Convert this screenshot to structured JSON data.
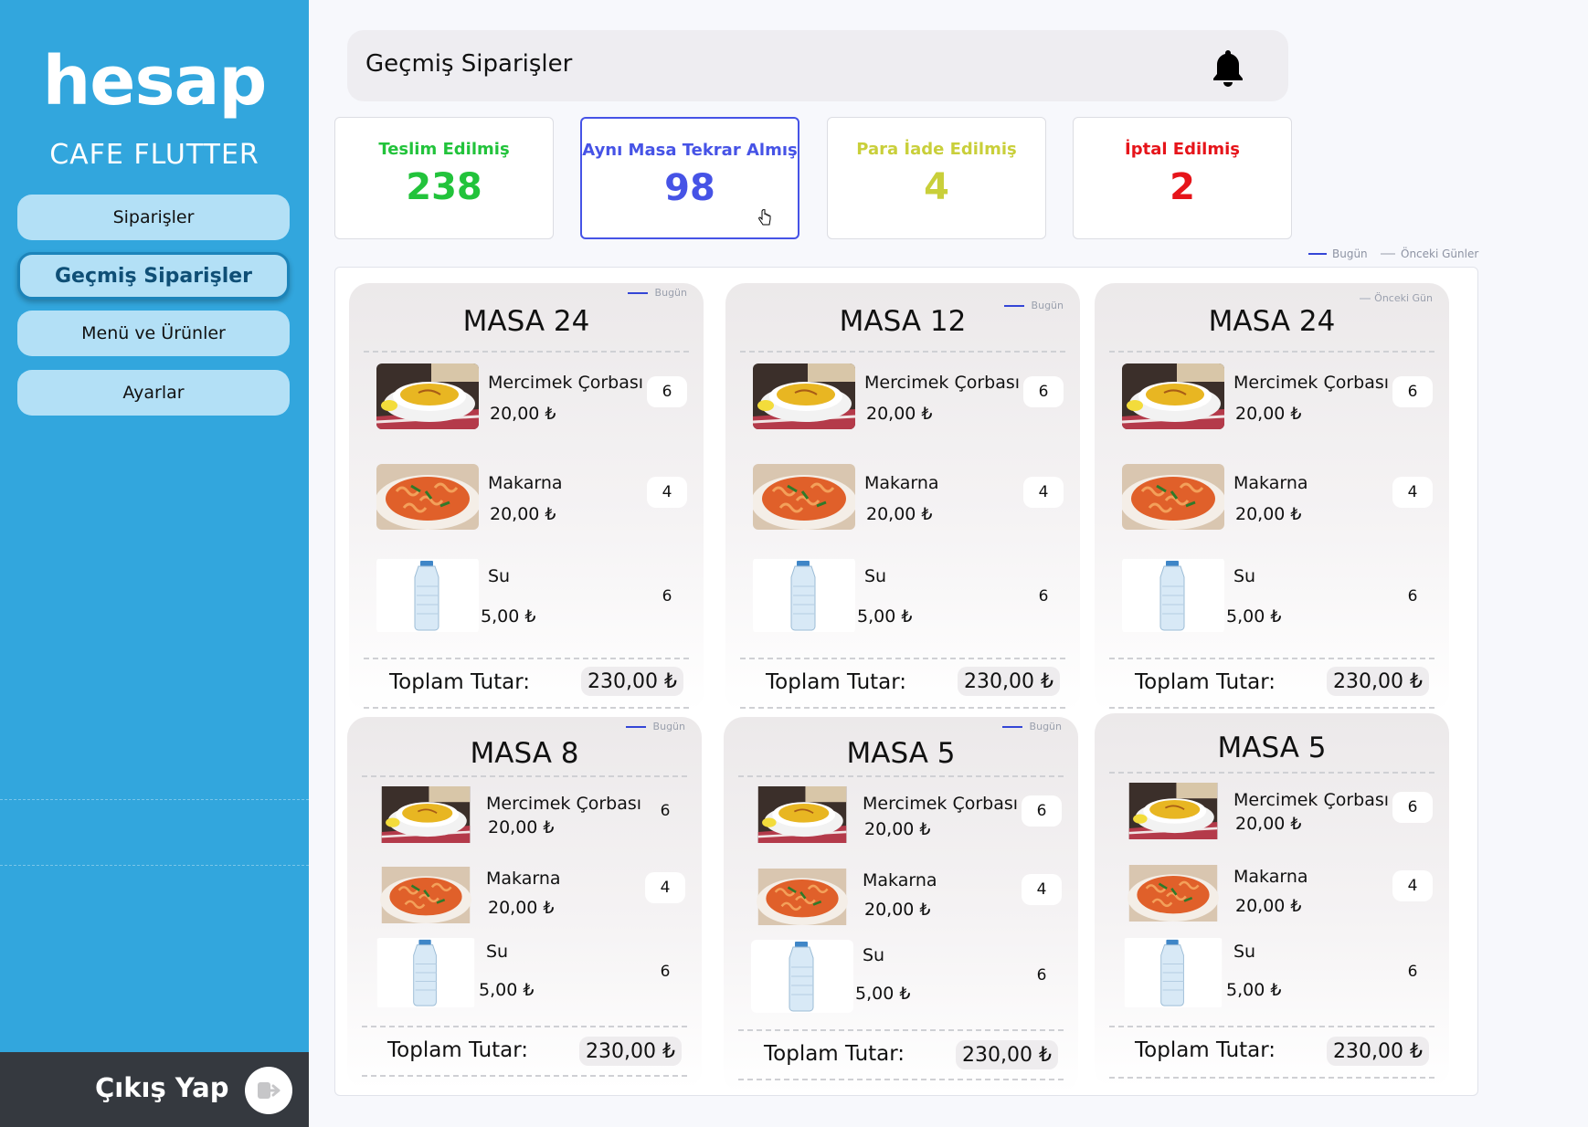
{
  "app": {
    "logo": "hesap",
    "brand": "CAFE FLUTTER"
  },
  "sidebar": {
    "items": [
      {
        "label": "Siparişler",
        "active": false
      },
      {
        "label": "Geçmiş Siparişler",
        "active": true
      },
      {
        "label": "Menü ve Ürünler",
        "active": false
      },
      {
        "label": "Ayarlar",
        "active": false
      }
    ],
    "logout_label": "Çıkış Yap"
  },
  "header": {
    "title": "Geçmiş Siparişler",
    "icon": "bell-icon"
  },
  "stats": [
    {
      "label": "Teslim Edilmiş",
      "value": "238",
      "color": "#22c33b"
    },
    {
      "label": "Aynı Masa Tekrar Almış",
      "value": "98",
      "color": "#4653e6"
    },
    {
      "label": "Para İade Edilmiş",
      "value": "4",
      "color": "#c9cf3a"
    },
    {
      "label": "İptal Edilmiş",
      "value": "2",
      "color": "#e6141a"
    }
  ],
  "legend": {
    "today": "Bugün",
    "previous": "Önceki Günler",
    "today_color": "#3446d6",
    "previous_color": "#c8cbd3"
  },
  "orders": [
    {
      "table": "MASA 24",
      "badge": "Bugün",
      "items": [
        {
          "name": "Mercimek Çorbası",
          "price": "20,00 ₺",
          "qty": "6",
          "image": "lentil-soup"
        },
        {
          "name": "Makarna",
          "price": "20,00 ₺",
          "qty": "4",
          "image": "pasta"
        },
        {
          "name": "Su",
          "price": "5,00 ₺",
          "qty": "6",
          "image": "water-bottle"
        }
      ],
      "total_label": "Toplam Tutar:",
      "total": "230,00 ₺"
    },
    {
      "table": "MASA 12",
      "badge": "Bugün",
      "items": [
        {
          "name": "Mercimek Çorbası",
          "price": "20,00 ₺",
          "qty": "6",
          "image": "lentil-soup"
        },
        {
          "name": "Makarna",
          "price": "20,00 ₺",
          "qty": "4",
          "image": "pasta"
        },
        {
          "name": "Su",
          "price": "5,00 ₺",
          "qty": "6",
          "image": "water-bottle"
        }
      ],
      "total_label": "Toplam Tutar:",
      "total": "230,00 ₺"
    },
    {
      "table": "MASA 24",
      "badge": "Önceki Gün",
      "items": [
        {
          "name": "Mercimek Çorbası",
          "price": "20,00 ₺",
          "qty": "6",
          "image": "lentil-soup"
        },
        {
          "name": "Makarna",
          "price": "20,00 ₺",
          "qty": "4",
          "image": "pasta"
        },
        {
          "name": "Su",
          "price": "5,00 ₺",
          "qty": "6",
          "image": "water-bottle"
        }
      ],
      "total_label": "Toplam Tutar:",
      "total": "230,00 ₺"
    },
    {
      "table": "MASA 8",
      "badge": "Bugün",
      "items": [
        {
          "name": "Mercimek Çorbası",
          "price": "20,00 ₺",
          "qty": "6",
          "image": "lentil-soup"
        },
        {
          "name": "Makarna",
          "price": "20,00 ₺",
          "qty": "4",
          "image": "pasta"
        },
        {
          "name": "Su",
          "price": "5,00 ₺",
          "qty": "6",
          "image": "water-bottle"
        }
      ],
      "total_label": "Toplam Tutar:",
      "total": "230,00 ₺"
    },
    {
      "table": "MASA 5",
      "badge": "Bugün",
      "items": [
        {
          "name": "Mercimek Çorbası",
          "price": "20,00 ₺",
          "qty": "6",
          "image": "lentil-soup"
        },
        {
          "name": "Makarna",
          "price": "20,00 ₺",
          "qty": "4",
          "image": "pasta"
        },
        {
          "name": "Su",
          "price": "5,00 ₺",
          "qty": "6",
          "image": "water-bottle"
        }
      ],
      "total_label": "Toplam Tutar:",
      "total": "230,00 ₺"
    },
    {
      "table": "MASA 5",
      "badge": "",
      "items": [
        {
          "name": "Mercimek Çorbası",
          "price": "20,00 ₺",
          "qty": "6",
          "image": "lentil-soup"
        },
        {
          "name": "Makarna",
          "price": "20,00 ₺",
          "qty": "4",
          "image": "pasta"
        },
        {
          "name": "Su",
          "price": "5,00 ₺",
          "qty": "6",
          "image": "water-bottle"
        }
      ],
      "total_label": "Toplam Tutar:",
      "total": "230,00 ₺"
    }
  ]
}
